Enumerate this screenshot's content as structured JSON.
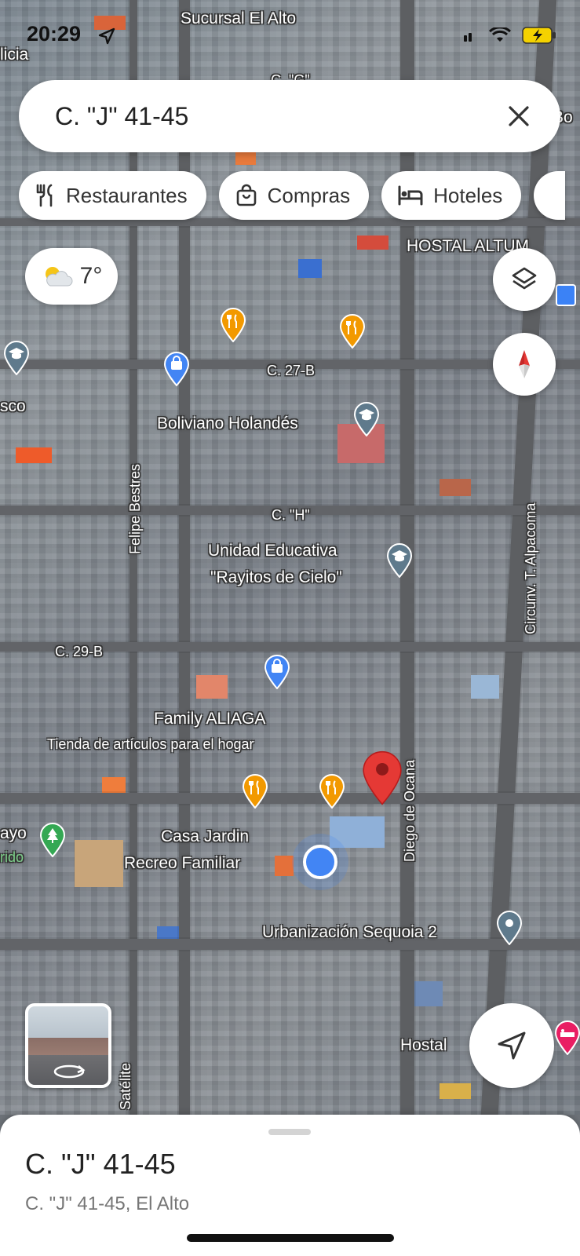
{
  "status_bar": {
    "time": "20:29"
  },
  "search": {
    "query": "C. \"J\" 41-45"
  },
  "chips": [
    {
      "label": "Restaurantes",
      "icon": "fork-knife-icon"
    },
    {
      "label": "Compras",
      "icon": "shopping-bag-icon"
    },
    {
      "label": "Hoteles",
      "icon": "bed-icon"
    }
  ],
  "weather": {
    "temperature": "7°",
    "icon": "partly-cloudy-icon"
  },
  "map_labels": {
    "top_place_1": "Sucursal El Alto",
    "top_edge_left": "licia",
    "street_c_g": "C. \"G\"",
    "hostal_altum": "HOSTAL ALTUM",
    "street_27b": "C. 27-B",
    "boliviano": "Boliviano Holandés",
    "sco": "sco",
    "street_h": "C. \"H\"",
    "felipe": "Felipe Bestres",
    "unidad_1": "Unidad Educativa",
    "unidad_2": "\"Rayitos de Cielo\"",
    "street_29b": "C. 29-B",
    "family": "Family ALIAGA",
    "tienda": "Tienda de artículos para el hogar",
    "diego": "Diego de Ocana",
    "circunv": "Circunv. T. Alpacoma",
    "casa_1": "Casa Jardin",
    "casa_2": "Recreo Familiar",
    "ayo": "ayo",
    "rido": "rido",
    "urbanizacion": "Urbanización Sequoia 2",
    "hostal": "Hostal",
    "satelite": "Satélite",
    "bo_edge": "Bo"
  },
  "colors": {
    "restaurant": "#f29900",
    "shopping": "#4285f4",
    "school": "#5f7a8c",
    "park": "#34a853",
    "selected_pin": "#e53935",
    "my_location": "#4285f4",
    "hotel": "#e91e63"
  },
  "sheet": {
    "title": "C. \"J\" 41-45",
    "subtitle": "C. \"J\" 41-45, El Alto"
  }
}
